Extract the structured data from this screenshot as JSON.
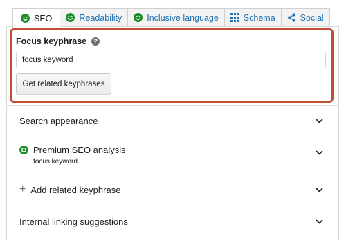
{
  "tabs": [
    {
      "label": "SEO",
      "icon": "smiley-green-icon",
      "active": true
    },
    {
      "label": "Readability",
      "icon": "smiley-green-icon",
      "active": false
    },
    {
      "label": "Inclusive language",
      "icon": "smiley-green-icon",
      "active": false
    },
    {
      "label": "Schema",
      "icon": "grid-icon",
      "active": false
    },
    {
      "label": "Social",
      "icon": "share-icon",
      "active": false
    }
  ],
  "focus": {
    "label": "Focus keyphrase",
    "help": "?",
    "value": "focus keyword",
    "button": "Get related keyphrases"
  },
  "sections": [
    {
      "title": "Search appearance"
    },
    {
      "title": "Premium SEO analysis",
      "subtitle": "focus keyword",
      "icon": "smiley-green-icon"
    },
    {
      "title": "Add related keyphrase",
      "icon": "plus-icon"
    },
    {
      "title": "Internal linking suggestions"
    }
  ],
  "colors": {
    "accent": "#2271b1",
    "highlight_border": "#c14e2f",
    "good": "#1e8d2a"
  }
}
